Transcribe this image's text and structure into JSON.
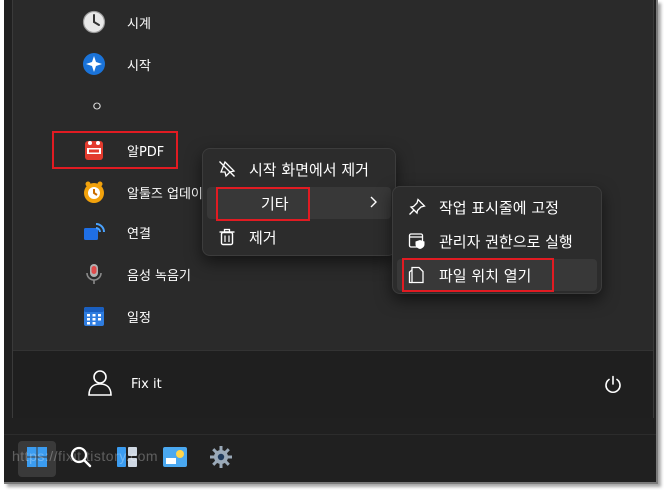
{
  "apps": [
    {
      "name": "clock",
      "label": "시계"
    },
    {
      "name": "start",
      "label": "시작"
    },
    {
      "name": "alpdf",
      "label": "알PDF"
    },
    {
      "name": "altools-update",
      "label": "알툴즈 업데이트"
    },
    {
      "name": "connect",
      "label": "연결"
    },
    {
      "name": "voice-recorder",
      "label": "음성 녹음기"
    },
    {
      "name": "calendar",
      "label": "일정"
    }
  ],
  "letter_header": "ㅇ",
  "user": {
    "name": "Fix it"
  },
  "context_menu": {
    "unpin": "시작 화면에서 제거",
    "more": "기타",
    "uninstall": "제거"
  },
  "submenu": {
    "pin_taskbar": "작업 표시줄에 고정",
    "run_as_admin": "관리자 권한으로 실행",
    "open_location": "파일 위치 열기"
  },
  "watermark": "https://fixit.tistory.com",
  "colors": {
    "highlight_red": "#e11b22",
    "start_blue": "#0078d4",
    "panel_bg": "#2a2a2a"
  }
}
